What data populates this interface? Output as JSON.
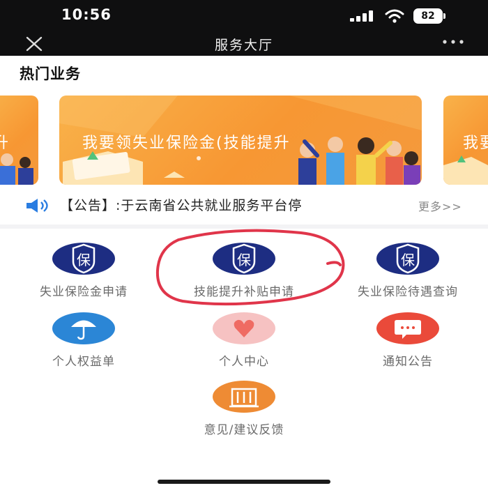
{
  "status_bar": {
    "time": "10:56",
    "battery": "82"
  },
  "nav": {
    "title": "服务大厅"
  },
  "hot": {
    "title": "热门业务",
    "cards": [
      {
        "text": "升"
      },
      {
        "text": "我要领失业保险金(技能提升"
      },
      {
        "text": "我要"
      }
    ]
  },
  "notice": {
    "text": "【公告】:于云南省公共就业服务平台停",
    "more": "更多>>"
  },
  "services": [
    {
      "label": "失业保险金申请",
      "icon": "shield-bao-icon",
      "icon_char": "保",
      "color": "#1d2d82"
    },
    {
      "label": "技能提升补贴申请",
      "icon": "shield-bao-icon",
      "icon_char": "保",
      "color": "#1d2d82"
    },
    {
      "label": "失业保险待遇查询",
      "icon": "shield-bao-icon",
      "icon_char": "保",
      "color": "#1d2d82"
    },
    {
      "label": "个人权益单",
      "icon": "umbrella-icon",
      "color": "#2b86d6"
    },
    {
      "label": "个人中心",
      "icon": "heart-icon",
      "color": "#f6c2c2"
    },
    {
      "label": "通知公告",
      "icon": "chat-bubble-icon",
      "color": "#ea4a3a"
    },
    {
      "label": "意见/建议反馈",
      "icon": "building-icon",
      "color": "#ee8b34"
    }
  ]
}
